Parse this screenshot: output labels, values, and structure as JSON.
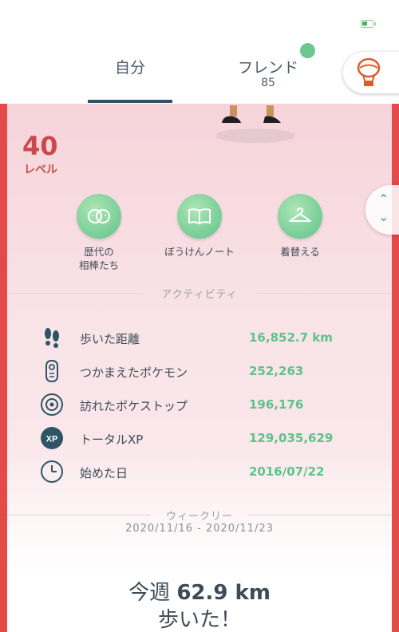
{
  "tabs": {
    "self": "自分",
    "friends": "フレンド",
    "friends_count": "85"
  },
  "level": {
    "number": "40",
    "label": "レベル"
  },
  "actions": {
    "buddies": {
      "line1": "歴代の",
      "line2": "相棒たち"
    },
    "journal": "ぼうけんノート",
    "style": "着替える"
  },
  "activity": {
    "heading": "アクティビティ",
    "stats": [
      {
        "icon": "footprints-icon",
        "name": "歩いた距離",
        "value": "16,852.7 km"
      },
      {
        "icon": "pokedex-icon",
        "name": "つかまえたポケモン",
        "value": "252,263"
      },
      {
        "icon": "pokestop-icon",
        "name": "訪れたポケストップ",
        "value": "196,176"
      },
      {
        "icon": "xp-icon",
        "name": "トータルXP",
        "value": "129,035,629"
      },
      {
        "icon": "clock-icon",
        "name": "始めた日",
        "value": "2016/07/22"
      }
    ]
  },
  "weekly": {
    "heading": "ウィークリー",
    "range": "2020/11/16 - 2020/11/23",
    "prefix": "今週",
    "distance": "62.9 km",
    "suffix": "歩いた！"
  },
  "colors": {
    "accent_green": "#5ec28a",
    "border_red": "#e34b4b",
    "text_dark": "#3e4b55"
  }
}
